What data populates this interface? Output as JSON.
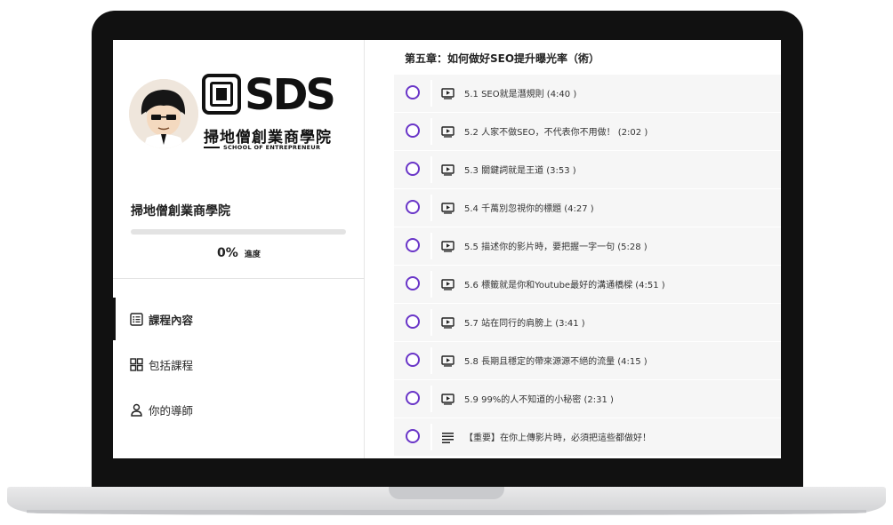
{
  "brand": {
    "logo_cn": "掃地僧創業商學院",
    "logo_en": "SCHOOL OF ENTREPRENEUR",
    "logo_letters": "SDS"
  },
  "sidebar": {
    "school_name": "掃地僧創業商學院",
    "progress": {
      "percent_label": "0%",
      "unit_label": "進度",
      "fraction": 0
    },
    "nav": [
      {
        "label": "課程內容",
        "icon": "list-icon",
        "active": true
      },
      {
        "label": "包括課程",
        "icon": "grid-icon",
        "active": false
      },
      {
        "label": "你的導師",
        "icon": "user-icon",
        "active": false
      }
    ]
  },
  "main": {
    "section_title": "第五章：如何做好SEO提升曝光率（術）",
    "lessons": [
      {
        "title": "5.1 SEO就是潛規則 (4:40 )",
        "icon": "video-icon"
      },
      {
        "title": "5.2 人家不做SEO，不代表你不用做！ (2:02 )",
        "icon": "video-icon"
      },
      {
        "title": "5.3 關鍵詞就是王道 (3:53 )",
        "icon": "video-icon"
      },
      {
        "title": "5.4 千萬別忽視你的標題 (4:27 )",
        "icon": "video-icon"
      },
      {
        "title": "5.5 描述你的影片時，要把握一字一句 (5:28 )",
        "icon": "video-icon"
      },
      {
        "title": "5.6 標籤就是你和Youtube最好的溝通橋樑 (4:51 )",
        "icon": "video-icon"
      },
      {
        "title": "5.7 站在同行的肩膀上 (3:41 )",
        "icon": "video-icon"
      },
      {
        "title": "5.8 長期且穩定的帶來源源不絕的流量 (4:15 )",
        "icon": "video-icon"
      },
      {
        "title": "5.9 99%的人不知道的小秘密 (2:31 )",
        "icon": "video-icon"
      },
      {
        "title": "【重要】在你上傳影片時，必須把這些都做好！",
        "icon": "text-icon"
      }
    ]
  },
  "colors": {
    "check_ring": "#6a36c8",
    "lesson_bg": "#f6f6f6",
    "progress_track": "#e3e3e3",
    "bezel": "#111111"
  }
}
